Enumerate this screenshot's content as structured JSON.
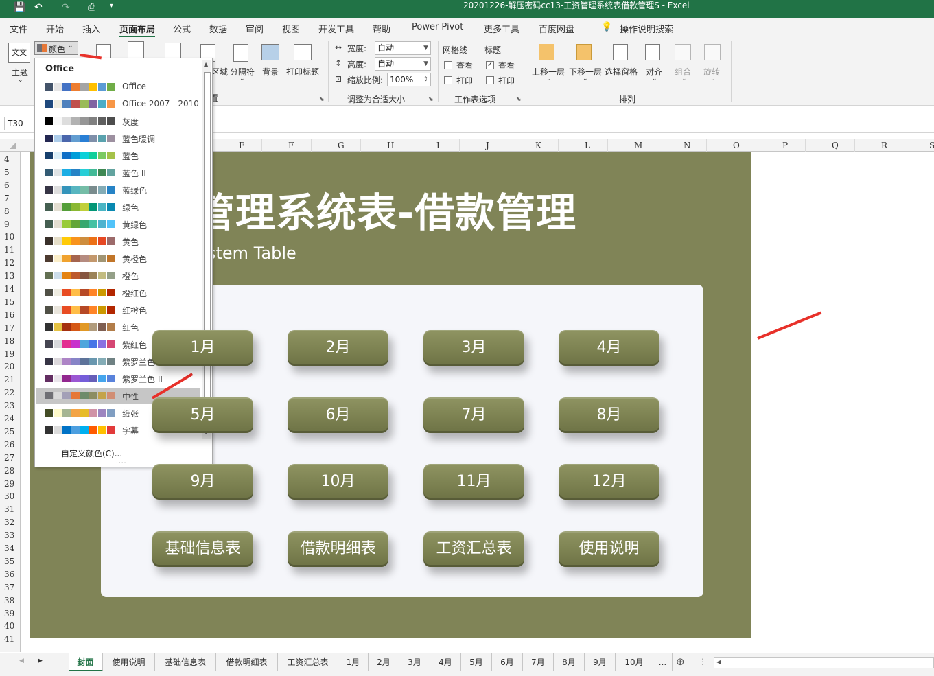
{
  "titlebar": {
    "title": "20201226-解压密码cc13-工资管理系统表借款管理S  -  Excel"
  },
  "menu": [
    "文件",
    "开始",
    "插入",
    "页面布局",
    "公式",
    "数据",
    "审阅",
    "视图",
    "开发工具",
    "帮助",
    "Power Pivot",
    "更多工具",
    "百度网盘",
    "操作说明搜索"
  ],
  "ribbon": {
    "themes_label": "主题",
    "colors_label": "颜色",
    "area_label": "区域",
    "breaks_label": "分隔符",
    "background_label": "背景",
    "print_titles_label": "打印标题",
    "width_label": "宽度:",
    "width_value": "自动",
    "height_label": "高度:",
    "height_value": "自动",
    "scale_label": "缩放比例:",
    "scale_value": "100%",
    "scale_group": "调整为合适大小",
    "gridlines_label": "网格线",
    "headings_label": "标题",
    "view_label": "查看",
    "print_label": "打印",
    "sheet_options_group": "工作表选项",
    "bring_forward": "上移一层",
    "send_backward": "下移一层",
    "selection_pane": "选择窗格",
    "align": "对齐",
    "group": "组合",
    "rotate": "旋转",
    "arrange_group": "排列",
    "setup_group_suffix": "置"
  },
  "namebox": "T30",
  "columns": [
    "E",
    "F",
    "G",
    "H",
    "I",
    "J",
    "K",
    "L",
    "M",
    "N",
    "O",
    "P",
    "Q",
    "R",
    "S"
  ],
  "rows": [
    "4",
    "5",
    "6",
    "7",
    "8",
    "9",
    "10",
    "11",
    "12",
    "13",
    "14",
    "15",
    "16",
    "17",
    "18",
    "19",
    "20",
    "21",
    "22",
    "23",
    "24",
    "25",
    "26",
    "27",
    "28",
    "29",
    "30",
    "31",
    "32",
    "33",
    "34",
    "35",
    "36",
    "37",
    "38",
    "39",
    "40",
    "41"
  ],
  "sheet": {
    "title": "管理系统表-借款管理",
    "subtitle": "stem  Table",
    "buttons": [
      "1月",
      "2月",
      "3月",
      "4月",
      "5月",
      "6月",
      "7月",
      "8月",
      "9月",
      "10月",
      "11月",
      "12月",
      "基础信息表",
      "借款明细表",
      "工资汇总表",
      "使用说明"
    ]
  },
  "colors_dropdown": {
    "header": "Office",
    "custom": "自定义颜色(C)...",
    "items": [
      {
        "label": "Office",
        "colors": [
          "#44546a",
          "#e7e6e6",
          "#4472c4",
          "#ed7d31",
          "#a5a5a5",
          "#ffc000",
          "#5b9bd5",
          "#70ad47"
        ]
      },
      {
        "label": "Office 2007 - 2010",
        "colors": [
          "#1f497d",
          "#eeece1",
          "#4f81bd",
          "#c0504d",
          "#9bbb59",
          "#8064a2",
          "#4bacc6",
          "#f79646"
        ]
      },
      {
        "label": "灰度",
        "colors": [
          "#000000",
          "#f8f8f8",
          "#dddddd",
          "#b2b2b2",
          "#969696",
          "#808080",
          "#5f5f5f",
          "#4d4d4d"
        ]
      },
      {
        "label": "蓝色暖调",
        "colors": [
          "#242852",
          "#acccea",
          "#4a66ac",
          "#629dd1",
          "#297fd5",
          "#7f8fa9",
          "#5aa2ae",
          "#9d90a0"
        ]
      },
      {
        "label": "蓝色",
        "colors": [
          "#17406d",
          "#dbeff9",
          "#0f6fc6",
          "#009dd9",
          "#0bd0d9",
          "#10cf9b",
          "#7cca62",
          "#a5c249"
        ]
      },
      {
        "label": "蓝色 II",
        "colors": [
          "#335b74",
          "#dfe3e5",
          "#1cade4",
          "#2683c6",
          "#27ced7",
          "#42ba97",
          "#3e8853",
          "#62a39f"
        ]
      },
      {
        "label": "蓝绿色",
        "colors": [
          "#373545",
          "#dedede",
          "#3494ba",
          "#58b6c0",
          "#75bda7",
          "#7a8c8e",
          "#84acb6",
          "#2683c6"
        ]
      },
      {
        "label": "绿色",
        "colors": [
          "#455f51",
          "#e3ded1",
          "#549e39",
          "#8ab833",
          "#c0cf3a",
          "#029676",
          "#4ab5c4",
          "#0989b1"
        ]
      },
      {
        "label": "黄绿色",
        "colors": [
          "#455f51",
          "#e3ded1",
          "#99cb38",
          "#63a537",
          "#37a76f",
          "#44c1a3",
          "#4eb3cf",
          "#51c3f9"
        ]
      },
      {
        "label": "黄色",
        "colors": [
          "#39302a",
          "#e5dec9",
          "#ffca08",
          "#f8931d",
          "#ce8d3e",
          "#ec7016",
          "#e64823",
          "#9c6a6a"
        ]
      },
      {
        "label": "黄橙色",
        "colors": [
          "#4e3b30",
          "#fbeec9",
          "#f0a22e",
          "#a5644e",
          "#b58b80",
          "#c3986d",
          "#a19574",
          "#c17529"
        ]
      },
      {
        "label": "橙色",
        "colors": [
          "#637052",
          "#ccddea",
          "#e48312",
          "#bd582c",
          "#865640",
          "#9b8357",
          "#c2bc80",
          "#94a088"
        ]
      },
      {
        "label": "橙红色",
        "colors": [
          "#505046",
          "#eeece1",
          "#e84c22",
          "#ffbd47",
          "#b64926",
          "#ff8427",
          "#cc9900",
          "#b22600"
        ]
      },
      {
        "label": "红橙色",
        "colors": [
          "#505046",
          "#e9e5dc",
          "#e84c22",
          "#ffbd47",
          "#b64926",
          "#ff8427",
          "#cc9900",
          "#b22600"
        ]
      },
      {
        "label": "红色",
        "colors": [
          "#323232",
          "#e5c243",
          "#a5300f",
          "#d55816",
          "#e19825",
          "#b19c7d",
          "#7f5f52",
          "#b27d49"
        ]
      },
      {
        "label": "紫红色",
        "colors": [
          "#454551",
          "#d8d9dc",
          "#e32d91",
          "#c830cc",
          "#4ea6dc",
          "#4775e7",
          "#8971e1",
          "#d54773"
        ]
      },
      {
        "label": "紫罗兰色",
        "colors": [
          "#373545",
          "#dcd8dc",
          "#ad84c6",
          "#8784c7",
          "#5d739a",
          "#6997af",
          "#84acb6",
          "#6f8183"
        ]
      },
      {
        "label": "紫罗兰色 II",
        "colors": [
          "#632e62",
          "#eae5eb",
          "#92278f",
          "#9b57d3",
          "#755dd9",
          "#665eb8",
          "#45a5ed",
          "#5982db"
        ]
      },
      {
        "label": "中性",
        "colors": [
          "#6f6f74",
          "#d9d9d9",
          "#a3a0b7",
          "#e67838",
          "#6e8b6b",
          "#8c8d62",
          "#c4a34a",
          "#d18e74"
        ]
      },
      {
        "label": "纸张",
        "colors": [
          "#444d26",
          "#fefac9",
          "#a5b592",
          "#f3a447",
          "#e7bc29",
          "#d092a7",
          "#9c85c0",
          "#809ec2"
        ]
      },
      {
        "label": "字幕",
        "colors": [
          "#323232",
          "#dcdcdc",
          "#0072c6",
          "#4c9fe0",
          "#00b0f0",
          "#ff5b00",
          "#ffc000",
          "#e23a3a"
        ]
      }
    ],
    "selected": "中性"
  },
  "tabs": [
    "封面",
    "使用说明",
    "基础信息表",
    "借款明细表",
    "工资汇总表",
    "1月",
    "2月",
    "3月",
    "4月",
    "5月",
    "6月",
    "7月",
    "8月",
    "9月",
    "10月",
    "..."
  ],
  "active_tab": "封面",
  "colors": {
    "sheet_bg": "#808457",
    "excel_green": "#217346",
    "button": "#7b8050"
  }
}
